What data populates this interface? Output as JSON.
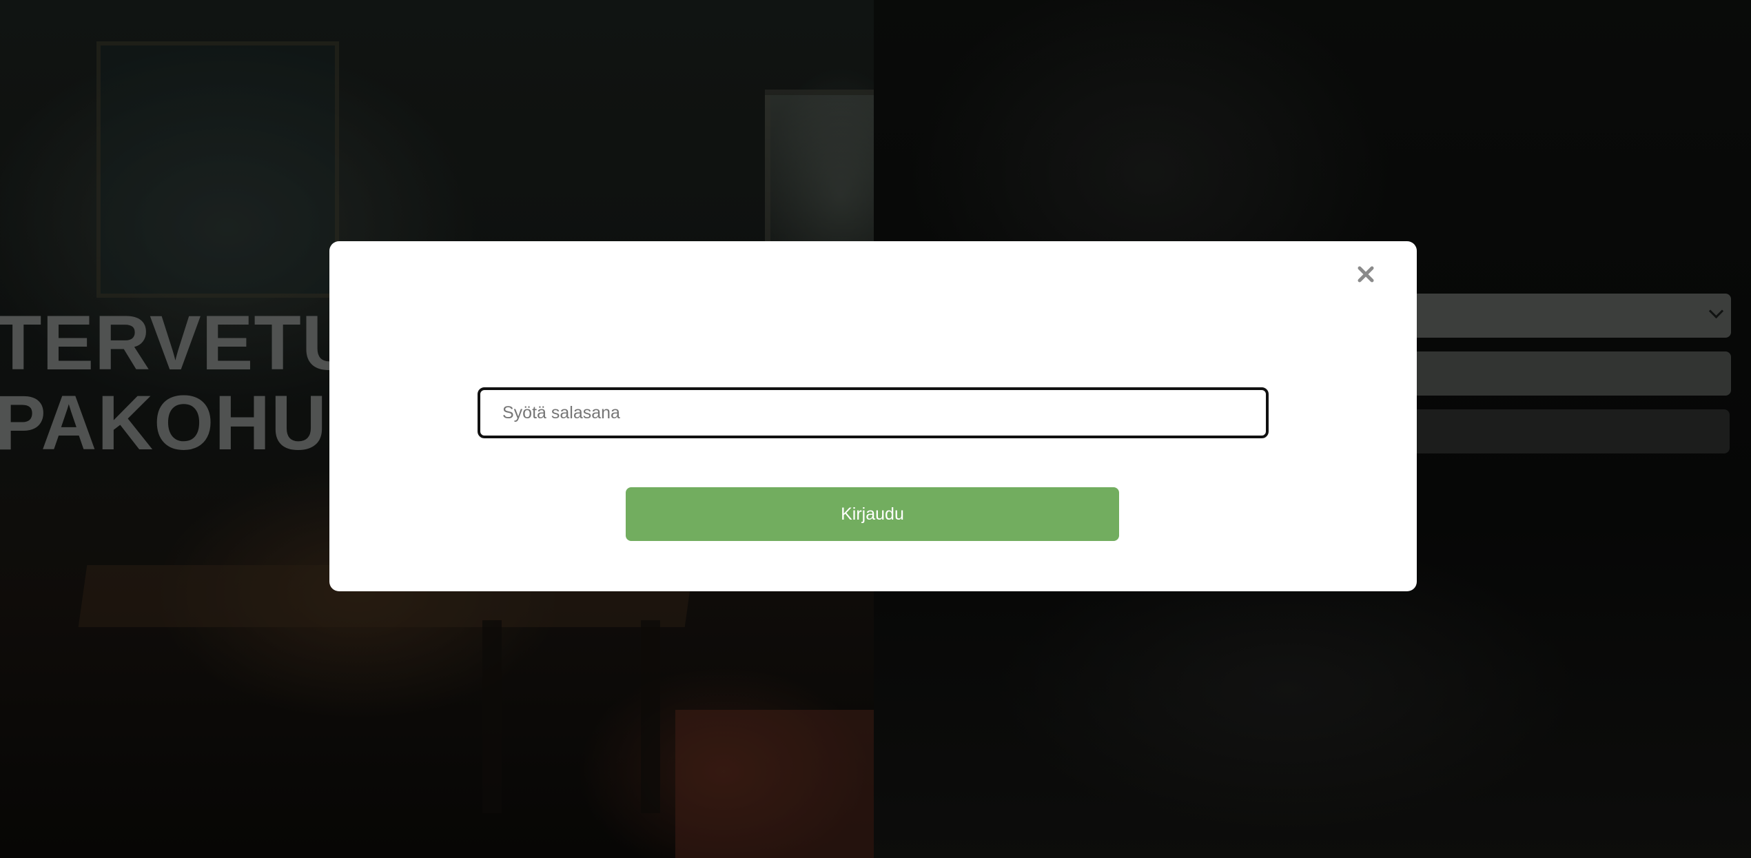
{
  "background": {
    "headline_line1": "TERVETUI",
    "headline_line2": "PAKOHUO"
  },
  "modal": {
    "title": "",
    "password_placeholder": "Syötä salasana",
    "password_value": "",
    "login_label": "Kirjaudu",
    "close_icon": "close-icon"
  },
  "colors": {
    "accent_green": "#72ad5f",
    "modal_bg": "#ffffff",
    "input_border": "#111111"
  }
}
